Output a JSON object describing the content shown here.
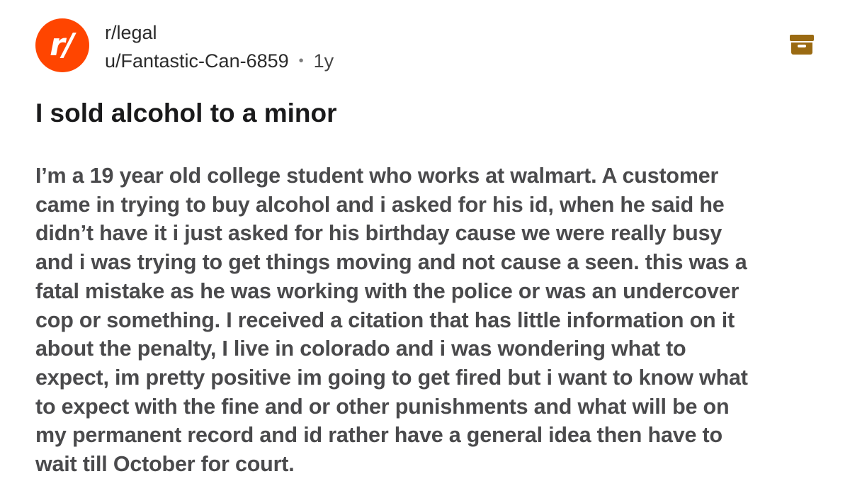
{
  "post": {
    "avatar": {
      "icon": "reddit-subreddit-icon",
      "glyph": "r/",
      "color": "#ff4500"
    },
    "subreddit": "r/legal",
    "author": "u/Fantastic-Can-6859",
    "separator": "•",
    "age": "1y",
    "archive_icon": "archive-box-icon",
    "title": "I sold alcohol to a minor",
    "body_lines": [
      "I’m a 19 year old college student who works at walmart. A customer",
      "came in trying to buy alcohol and i asked for his id, when he said he",
      "didn’t have it i just asked for his birthday cause we were really busy",
      "and i was trying to get things moving and not cause a seen. this was a",
      "fatal mistake as he was working with the police or was an undercover",
      "cop or something. I received a citation that has little information on it",
      "about the penalty, I live in colorado and i was wondering what to",
      "expect, im pretty positive im going to get fired but i want to know what",
      "to expect with the fine and or other punishments and what will be on",
      "my permanent record and id rather have a general idea then have to",
      "wait till October for court."
    ]
  },
  "colors": {
    "accent": "#ff4500",
    "archive_icon": "#9a6a12",
    "title_text": "#1a1a1b",
    "body_text": "#4a4a4c"
  }
}
